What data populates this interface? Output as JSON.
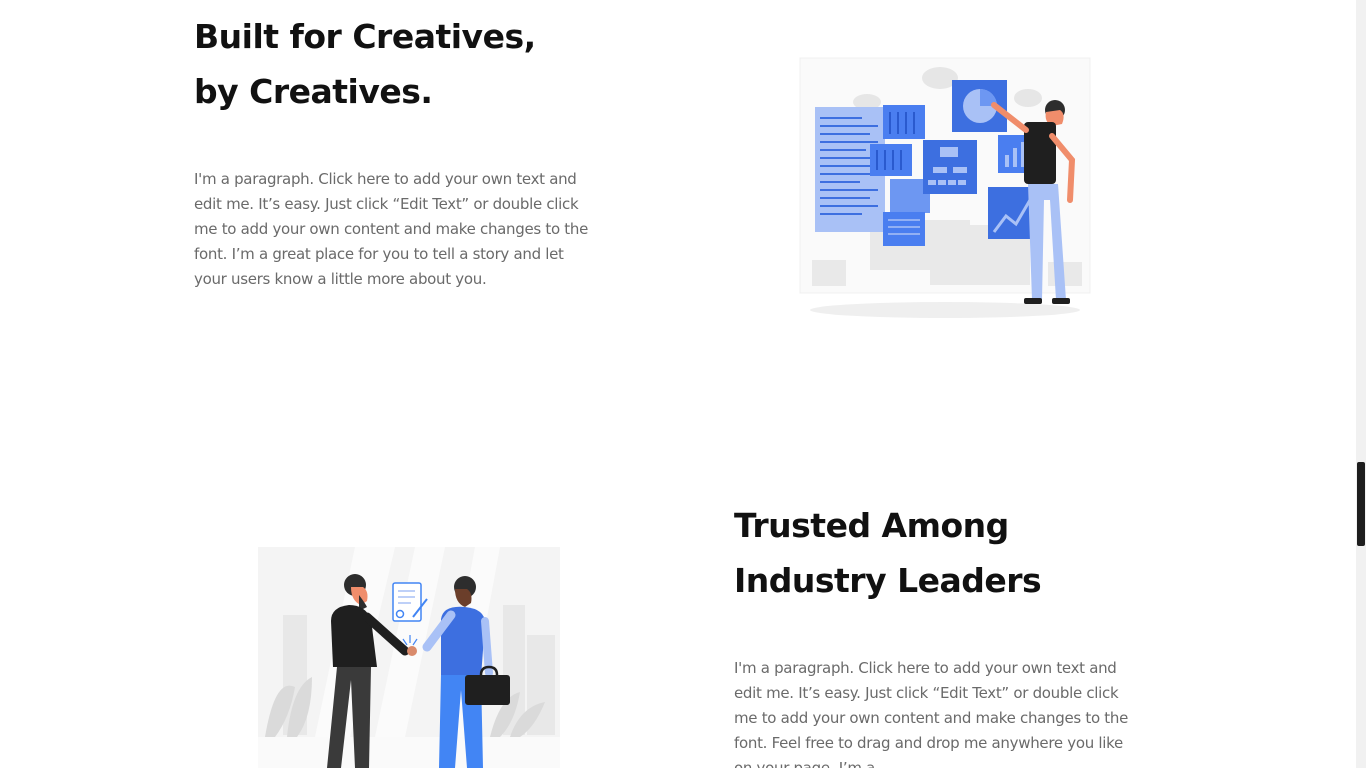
{
  "section_1": {
    "heading_line_1": "Built for Creatives,",
    "heading_line_2": "by Creatives.",
    "paragraph": "I'm a paragraph. Click here to add your own text and edit me. It’s easy. Just click “Edit Text” or double click me to add your own content and make changes to the font. I’m a great place for you to tell a story and let your users know a little more about you.",
    "illustration_icon": "person-with-dashboard-screens-illustration"
  },
  "section_2": {
    "heading_line_1": "Trusted Among",
    "heading_line_2": "Industry Leaders",
    "paragraph": "I'm a paragraph. Click here to add your own text and edit me. It’s easy. Just click “Edit Text” or double click me to add your own content and make changes to the font. Feel free to drag and drop me anywhere you like on your page. I’m a",
    "illustration_icon": "handshake-business-deal-illustration"
  },
  "colors": {
    "accent_blue": "#4285f4",
    "heading_text": "#111111",
    "paragraph_text": "#6a6a6a",
    "scrollbar_thumb": "#1e1e1e"
  }
}
